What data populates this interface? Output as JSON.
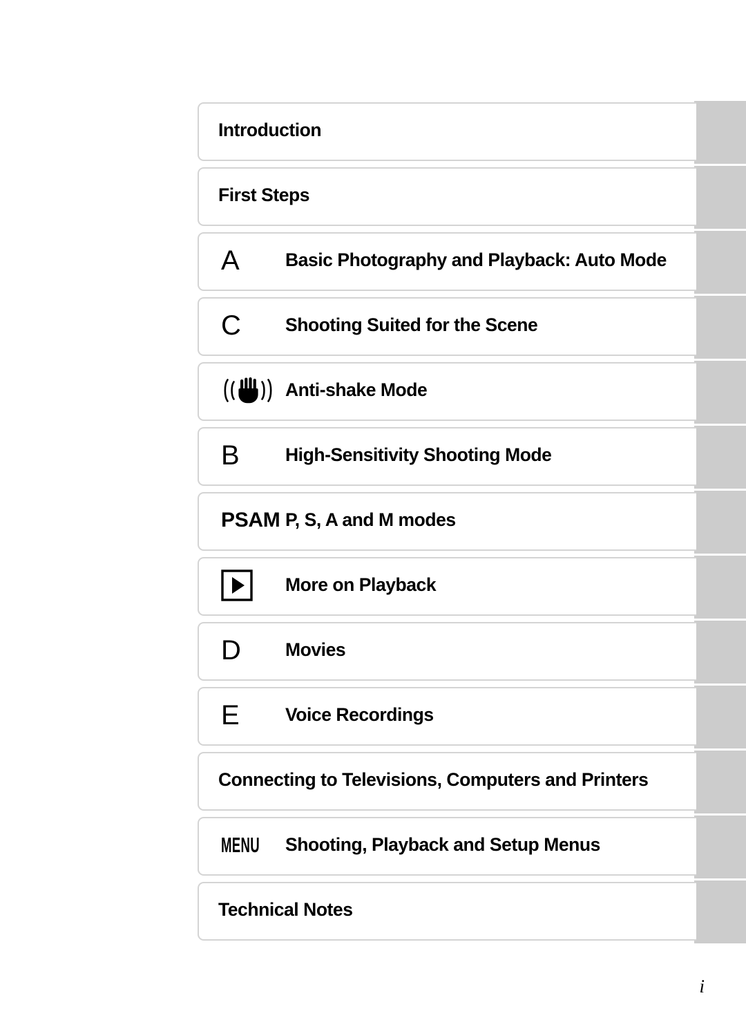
{
  "page": {
    "folio": "i",
    "tab_color": "#cccccc",
    "card_border_color": "#d4d4d4",
    "background": "#ffffff"
  },
  "chapters": [
    {
      "symbol_type": "none",
      "symbol": "",
      "label": "Introduction"
    },
    {
      "symbol_type": "none",
      "symbol": "",
      "label": "First Steps"
    },
    {
      "symbol_type": "letter",
      "symbol": "A",
      "label": "Basic Photography and Playback: Auto Mode"
    },
    {
      "symbol_type": "letter",
      "symbol": "C",
      "label": "Shooting Suited for the Scene"
    },
    {
      "symbol_type": "shake",
      "symbol": "((hand))",
      "label": "Anti-shake Mode"
    },
    {
      "symbol_type": "letter",
      "symbol": "B",
      "label": "High-Sensitivity Shooting Mode"
    },
    {
      "symbol_type": "psam",
      "symbol": "PSAM",
      "label": "P, S, A and M modes"
    },
    {
      "symbol_type": "playback",
      "symbol": "play",
      "label": "More on Playback"
    },
    {
      "symbol_type": "letter",
      "symbol": "D",
      "label": "Movies"
    },
    {
      "symbol_type": "letter",
      "symbol": "E",
      "label": "Voice Recordings"
    },
    {
      "symbol_type": "none",
      "symbol": "",
      "label": "Connecting to Televisions, Computers and Printers"
    },
    {
      "symbol_type": "menu",
      "symbol": "MENU",
      "label": "Shooting, Playback and Setup Menus"
    },
    {
      "symbol_type": "none",
      "symbol": "",
      "label": "Technical Notes"
    }
  ]
}
